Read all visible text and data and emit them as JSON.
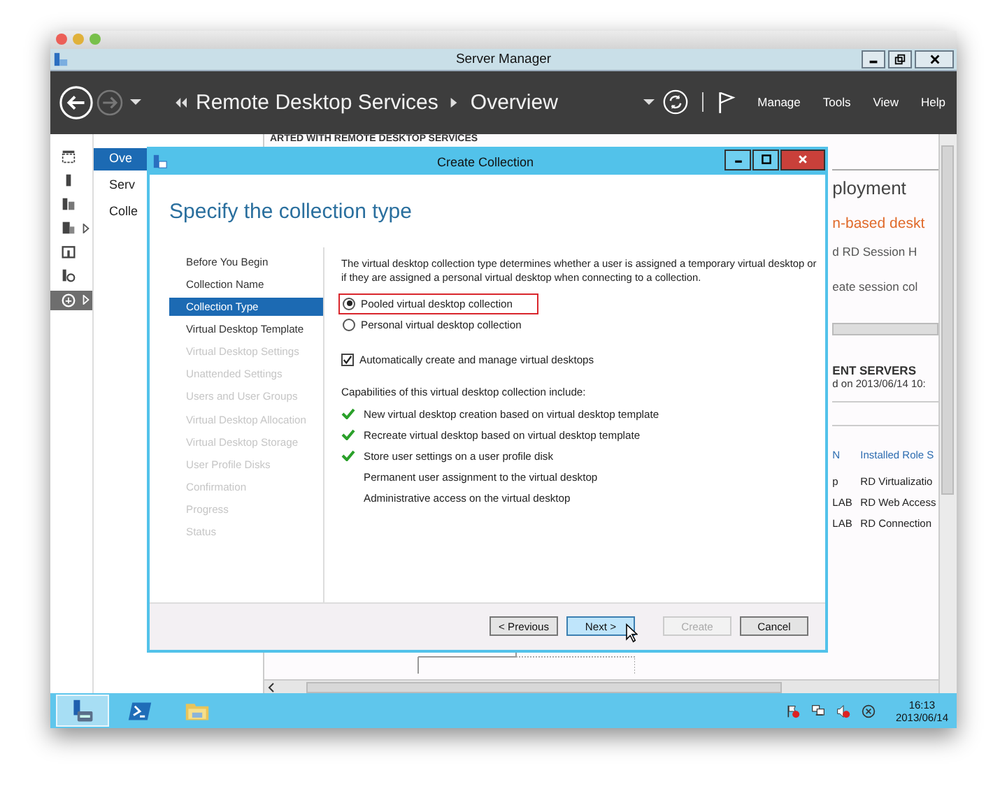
{
  "app": {
    "title": "Server Manager"
  },
  "header": {
    "breadcrumb": [
      "Remote Desktop Services",
      "Overview"
    ],
    "menus": [
      "Manage",
      "Tools",
      "View",
      "Help"
    ]
  },
  "left_icons": [
    {
      "selected": false,
      "expandable": false
    },
    {
      "selected": false,
      "expandable": false
    },
    {
      "selected": false,
      "expandable": false
    },
    {
      "selected": false,
      "expandable": true
    },
    {
      "selected": false,
      "expandable": false
    },
    {
      "selected": false,
      "expandable": false
    },
    {
      "selected": true,
      "expandable": true
    }
  ],
  "nav": [
    {
      "label": "Ove",
      "selected": true
    },
    {
      "label": "Serv",
      "selected": false
    },
    {
      "label": "Colle",
      "selected": false
    }
  ],
  "background": {
    "top_heading": "ARTED WITH REMOTE DESKTOP SERVICES",
    "title": "ployment",
    "link": "n-based deskt",
    "lines": [
      "d RD Session H",
      "eate session col"
    ],
    "servers_heading": "ENT SERVERS",
    "servers_subtitle": "d on 2013/06/14 10:",
    "table": {
      "columns": [
        "N",
        "Installed Role S"
      ],
      "rows": [
        [
          "p",
          "RD Virtualizatio"
        ],
        [
          "LAB",
          "RD Web Access"
        ],
        [
          "LAB",
          "RD Connection"
        ]
      ]
    }
  },
  "dialog": {
    "title": "Create Collection",
    "heading": "Specify the collection type",
    "steps": [
      {
        "label": "Before You Begin",
        "selected": false,
        "disabled": false
      },
      {
        "label": "Collection Name",
        "selected": false,
        "disabled": false
      },
      {
        "label": "Collection Type",
        "selected": true,
        "disabled": false
      },
      {
        "label": "Virtual Desktop Template",
        "selected": false,
        "disabled": false
      },
      {
        "label": "Virtual Desktop Settings",
        "selected": false,
        "disabled": true
      },
      {
        "label": "Unattended Settings",
        "selected": false,
        "disabled": true
      },
      {
        "label": "Users and User Groups",
        "selected": false,
        "disabled": true
      },
      {
        "label": "Virtual Desktop Allocation",
        "selected": false,
        "disabled": true
      },
      {
        "label": "Virtual Desktop Storage",
        "selected": false,
        "disabled": true
      },
      {
        "label": "User Profile Disks",
        "selected": false,
        "disabled": true
      },
      {
        "label": "Confirmation",
        "selected": false,
        "disabled": true
      },
      {
        "label": "Progress",
        "selected": false,
        "disabled": true
      },
      {
        "label": "Status",
        "selected": false,
        "disabled": true
      }
    ],
    "description": "The virtual desktop collection type determines whether a user is assigned a temporary virtual desktop or if they are assigned a personal virtual desktop when connecting to a collection.",
    "options": [
      {
        "label": "Pooled virtual desktop collection",
        "selected": true,
        "highlighted": true
      },
      {
        "label": "Personal virtual desktop collection",
        "selected": false,
        "highlighted": false
      }
    ],
    "auto_create": {
      "label": "Automatically create and manage virtual desktops",
      "checked": true
    },
    "capabilities_heading": "Capabilities of this virtual desktop collection include:",
    "capabilities": [
      {
        "label": "New virtual desktop creation based on virtual desktop template",
        "available": true
      },
      {
        "label": "Recreate virtual desktop based on virtual desktop template",
        "available": true
      },
      {
        "label": "Store user settings on a user profile disk",
        "available": true
      },
      {
        "label": "Permanent user assignment to the virtual desktop",
        "available": false
      },
      {
        "label": "Administrative access on the virtual desktop",
        "available": false
      }
    ],
    "buttons": [
      {
        "label": "< Previous",
        "disabled": false,
        "hovered": false
      },
      {
        "label": "Next >",
        "disabled": false,
        "hovered": true
      },
      {
        "label": "Create",
        "disabled": true,
        "hovered": false
      },
      {
        "label": "Cancel",
        "disabled": false,
        "hovered": false
      }
    ]
  },
  "taskbar": {
    "apps": [
      {
        "selected": true
      },
      {
        "selected": false
      },
      {
        "selected": false
      }
    ],
    "time": "16:13",
    "date": "2013/06/14"
  }
}
